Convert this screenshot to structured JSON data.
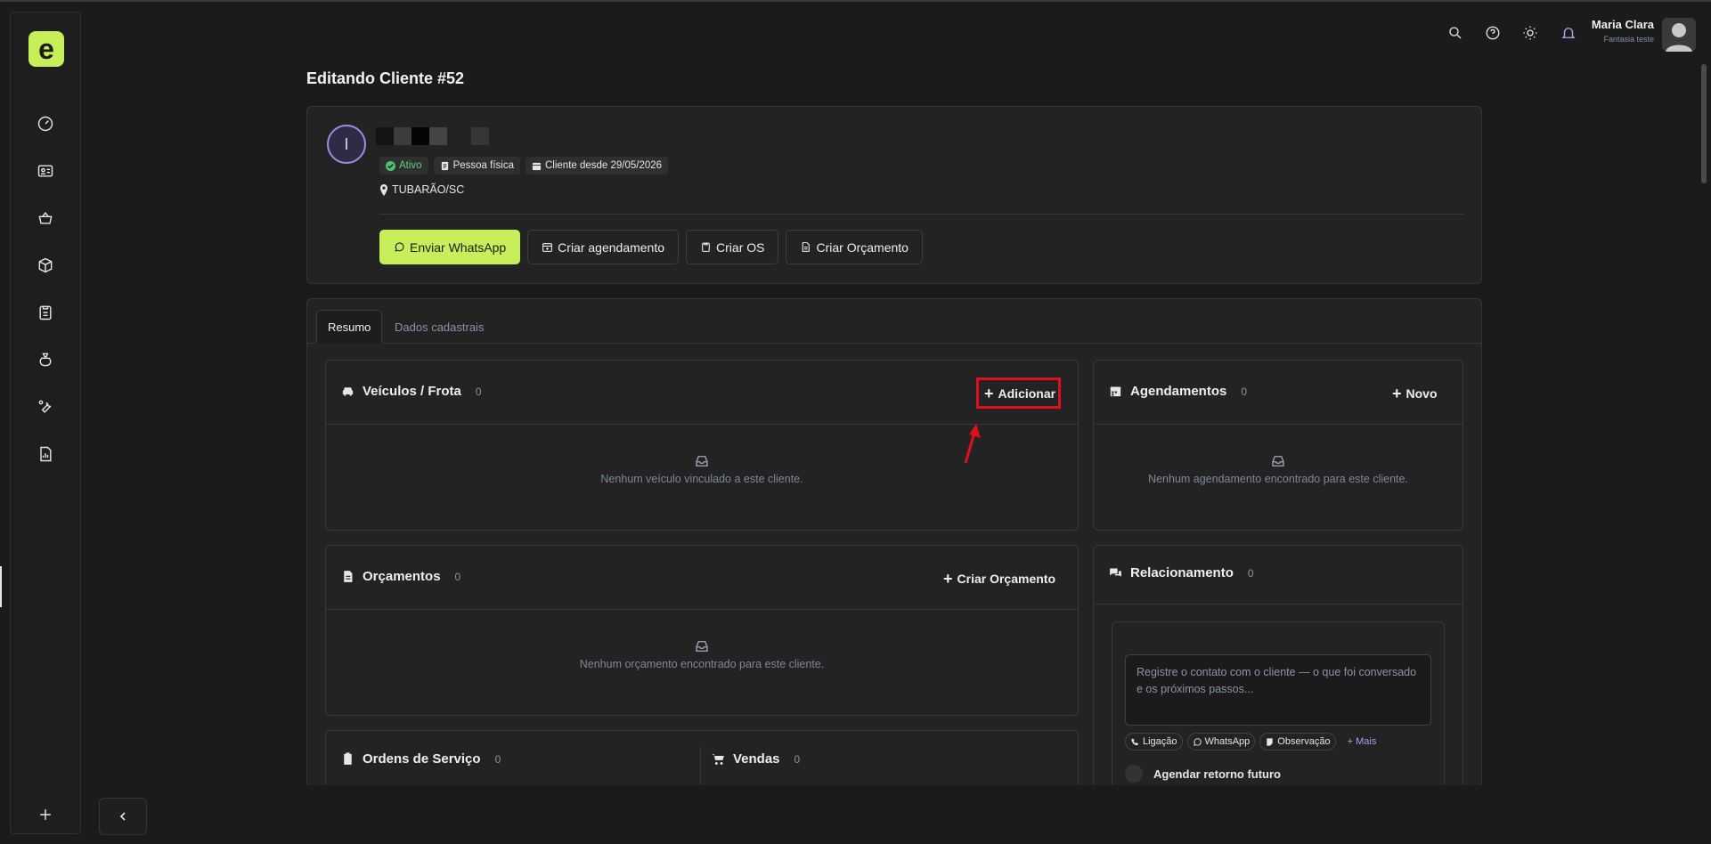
{
  "page": {
    "title": "Editando Cliente #52"
  },
  "topbar": {
    "icons": [
      "search-icon",
      "help-icon",
      "theme-sun-icon",
      "notifications-icon"
    ],
    "user": {
      "name": "Maria Clara",
      "subtitle": "Fantasia teste"
    }
  },
  "sidebar": {
    "logo": "e",
    "items": [
      "dashboard-icon",
      "clients-icon",
      "sales-basket-icon",
      "products-box-icon",
      "service-orders-icon",
      "finance-bag-icon",
      "tools-wrench-icon",
      "reports-icon"
    ],
    "add_icon": "plus-icon",
    "collapse_icon": "chevron-left-icon"
  },
  "client": {
    "initial": "I",
    "badges": {
      "status": "Ativo",
      "type": "Pessoa física",
      "since": "Cliente desde 29/05/2026"
    },
    "location": "TUBARÃO/SC",
    "actions": {
      "whatsapp": "Enviar WhatsApp",
      "schedule": "Criar agendamento",
      "os": "Criar OS",
      "quote": "Criar Orçamento"
    }
  },
  "tabs": [
    {
      "label": "Resumo",
      "active": true
    },
    {
      "label": "Dados cadastrais",
      "active": false
    }
  ],
  "sections": {
    "vehicles": {
      "title": "Veículos / Frota",
      "count": "0",
      "action": "Adicionar",
      "empty": "Nenhum veículo vinculado a este cliente."
    },
    "appointments": {
      "title": "Agendamentos",
      "count": "0",
      "action": "Novo",
      "empty": "Nenhum agendamento encontrado para este cliente."
    },
    "quotes": {
      "title": "Orçamentos",
      "count": "0",
      "action": "Criar Orçamento",
      "empty": "Nenhum orçamento encontrado para este cliente."
    },
    "relationship": {
      "title": "Relacionamento",
      "count": "0",
      "placeholder": "Registre o contato com o cliente — o que foi conversado e os próximos passos...",
      "chips": [
        "Ligação",
        "WhatsApp",
        "Observação"
      ],
      "more": "+ Mais",
      "toggle_label": "Agendar retorno futuro"
    },
    "service_orders": {
      "title": "Ordens de Serviço",
      "count": "0"
    },
    "sales": {
      "title": "Vendas",
      "count": "0"
    }
  },
  "colors": {
    "accent": "#c6ef5a",
    "highlight": "#e0101b",
    "background": "#1b1b1b",
    "card": "#232323"
  }
}
